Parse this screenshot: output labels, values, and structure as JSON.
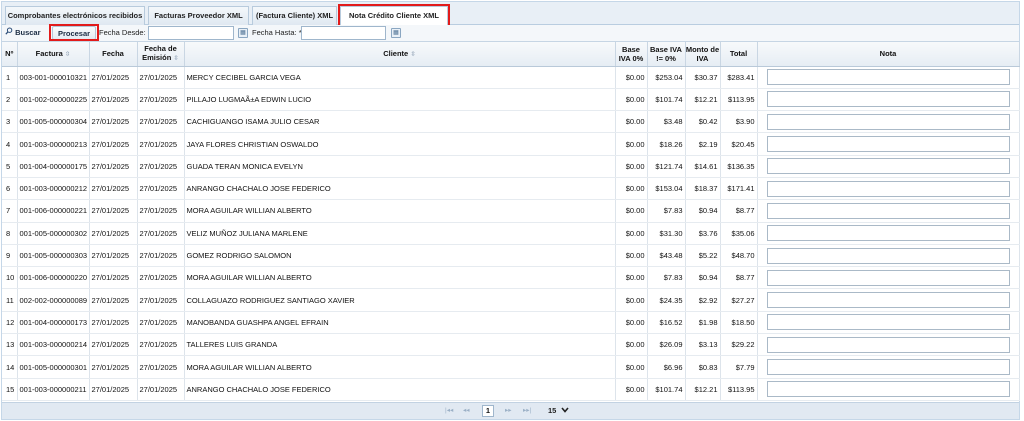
{
  "tabs": [
    {
      "label": "Comprobantes electrónicos recibidos"
    },
    {
      "label": "Facturas Proveedor XML"
    },
    {
      "label": "(Factura Cliente) XML"
    },
    {
      "label": "Nota Crédito Cliente XML"
    }
  ],
  "toolbar": {
    "search_icon": "search-icon",
    "buscar_label": "Buscar",
    "procesar_label": "Procesar",
    "fecha_desde_label": "Fecha Desde: *",
    "fecha_desde_value": "",
    "fecha_hasta_label": "Fecha Hasta: *",
    "fecha_hasta_value": "",
    "calendar_icon": "calendar-icon"
  },
  "table": {
    "columns": [
      "Nº",
      "Factura",
      "Fecha",
      "Fecha de Emisión",
      "Cliente",
      "Base IVA 0%",
      "Base IVA != 0%",
      "Monto de IVA",
      "Total",
      "Nota"
    ],
    "sort_icon": "⇳",
    "rows": [
      {
        "n": "1",
        "factura": "003-001-000010321",
        "fecha": "27/01/2025",
        "emision": "27/01/2025",
        "cliente": "MERCY CECIBEL GARCIA VEGA",
        "base0": "$0.00",
        "base12": "$253.04",
        "iva": "$30.37",
        "total": "$283.41",
        "nota": ""
      },
      {
        "n": "2",
        "factura": "001-002-000000225",
        "fecha": "27/01/2025",
        "emision": "27/01/2025",
        "cliente": "PILLAJO LUGMAÃ±A EDWIN LUCIO",
        "base0": "$0.00",
        "base12": "$101.74",
        "iva": "$12.21",
        "total": "$113.95",
        "nota": ""
      },
      {
        "n": "3",
        "factura": "001-005-000000304",
        "fecha": "27/01/2025",
        "emision": "27/01/2025",
        "cliente": "CACHIGUANGO ISAMA JULIO CESAR",
        "base0": "$0.00",
        "base12": "$3.48",
        "iva": "$0.42",
        "total": "$3.90",
        "nota": ""
      },
      {
        "n": "4",
        "factura": "001-003-000000213",
        "fecha": "27/01/2025",
        "emision": "27/01/2025",
        "cliente": "JAYA FLORES CHRISTIAN OSWALDO",
        "base0": "$0.00",
        "base12": "$18.26",
        "iva": "$2.19",
        "total": "$20.45",
        "nota": ""
      },
      {
        "n": "5",
        "factura": "001-004-000000175",
        "fecha": "27/01/2025",
        "emision": "27/01/2025",
        "cliente": "GUADA TERAN MONICA EVELYN",
        "base0": "$0.00",
        "base12": "$121.74",
        "iva": "$14.61",
        "total": "$136.35",
        "nota": ""
      },
      {
        "n": "6",
        "factura": "001-003-000000212",
        "fecha": "27/01/2025",
        "emision": "27/01/2025",
        "cliente": "ANRANGO CHACHALO JOSE FEDERICO",
        "base0": "$0.00",
        "base12": "$153.04",
        "iva": "$18.37",
        "total": "$171.41",
        "nota": ""
      },
      {
        "n": "7",
        "factura": "001-006-000000221",
        "fecha": "27/01/2025",
        "emision": "27/01/2025",
        "cliente": "MORA AGUILAR WILLIAN ALBERTO",
        "base0": "$0.00",
        "base12": "$7.83",
        "iva": "$0.94",
        "total": "$8.77",
        "nota": ""
      },
      {
        "n": "8",
        "factura": "001-005-000000302",
        "fecha": "27/01/2025",
        "emision": "27/01/2025",
        "cliente": "VELIZ MUÑOZ JULIANA MARLENE",
        "base0": "$0.00",
        "base12": "$31.30",
        "iva": "$3.76",
        "total": "$35.06",
        "nota": ""
      },
      {
        "n": "9",
        "factura": "001-005-000000303",
        "fecha": "27/01/2025",
        "emision": "27/01/2025",
        "cliente": "GOMEZ RODRIGO SALOMON",
        "base0": "$0.00",
        "base12": "$43.48",
        "iva": "$5.22",
        "total": "$48.70",
        "nota": ""
      },
      {
        "n": "10",
        "factura": "001-006-000000220",
        "fecha": "27/01/2025",
        "emision": "27/01/2025",
        "cliente": "MORA AGUILAR WILLIAN ALBERTO",
        "base0": "$0.00",
        "base12": "$7.83",
        "iva": "$0.94",
        "total": "$8.77",
        "nota": ""
      },
      {
        "n": "11",
        "factura": "002-002-000000089",
        "fecha": "27/01/2025",
        "emision": "27/01/2025",
        "cliente": "COLLAGUAZO RODRIGUEZ SANTIAGO XAVIER",
        "base0": "$0.00",
        "base12": "$24.35",
        "iva": "$2.92",
        "total": "$27.27",
        "nota": ""
      },
      {
        "n": "12",
        "factura": "001-004-000000173",
        "fecha": "27/01/2025",
        "emision": "27/01/2025",
        "cliente": "MANOBANDA GUASHPA ANGEL EFRAIN",
        "base0": "$0.00",
        "base12": "$16.52",
        "iva": "$1.98",
        "total": "$18.50",
        "nota": ""
      },
      {
        "n": "13",
        "factura": "001-003-000000214",
        "fecha": "27/01/2025",
        "emision": "27/01/2025",
        "cliente": "TALLERES LUIS GRANDA",
        "base0": "$0.00",
        "base12": "$26.09",
        "iva": "$3.13",
        "total": "$29.22",
        "nota": ""
      },
      {
        "n": "14",
        "factura": "001-005-000000301",
        "fecha": "27/01/2025",
        "emision": "27/01/2025",
        "cliente": "MORA AGUILAR WILLIAN ALBERTO",
        "base0": "$0.00",
        "base12": "$6.96",
        "iva": "$0.83",
        "total": "$7.79",
        "nota": ""
      },
      {
        "n": "15",
        "factura": "001-003-000000211",
        "fecha": "27/01/2025",
        "emision": "27/01/2025",
        "cliente": "ANRANGO CHACHALO JOSE FEDERICO",
        "base0": "$0.00",
        "base12": "$101.74",
        "iva": "$12.21",
        "total": "$113.95",
        "nota": ""
      }
    ]
  },
  "pager": {
    "first": "|◂◂",
    "prev": "◂◂",
    "current_page": "1",
    "next": "▸▸",
    "last": "▸▸|",
    "rows_per_page": "15"
  },
  "colors": {
    "highlight": "#e21b1b",
    "header_bg": "#e8eff6",
    "accent_blue": "#1b2c43"
  }
}
